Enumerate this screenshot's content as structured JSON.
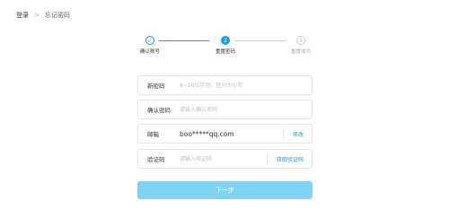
{
  "breadcrumb": {
    "login": "登录",
    "separator": ">",
    "current": "忘记密码"
  },
  "steps": [
    {
      "number": "✓",
      "label": "确认账号",
      "state": "done"
    },
    {
      "number": "2",
      "label": "重置密码",
      "state": "active"
    },
    {
      "number": "3",
      "label": "重置成功",
      "state": "pending"
    }
  ],
  "form": {
    "new_password": {
      "label": "新密码",
      "placeholder": "8~16位字符，区分大小写",
      "value": ""
    },
    "confirm_password": {
      "label": "确认密码",
      "placeholder": "请输入确认密码",
      "value": ""
    },
    "email": {
      "label": "邮箱",
      "value": "boo*****qq.com",
      "action": "修改"
    },
    "code": {
      "label": "验证码",
      "placeholder": "请输入验证码",
      "value": "",
      "action": "获取验证码"
    }
  },
  "next_button": "下一步",
  "colors": {
    "accent": "#1aa0dd",
    "button_bg": "#7fd3f3",
    "border": "#e6e6e6"
  }
}
